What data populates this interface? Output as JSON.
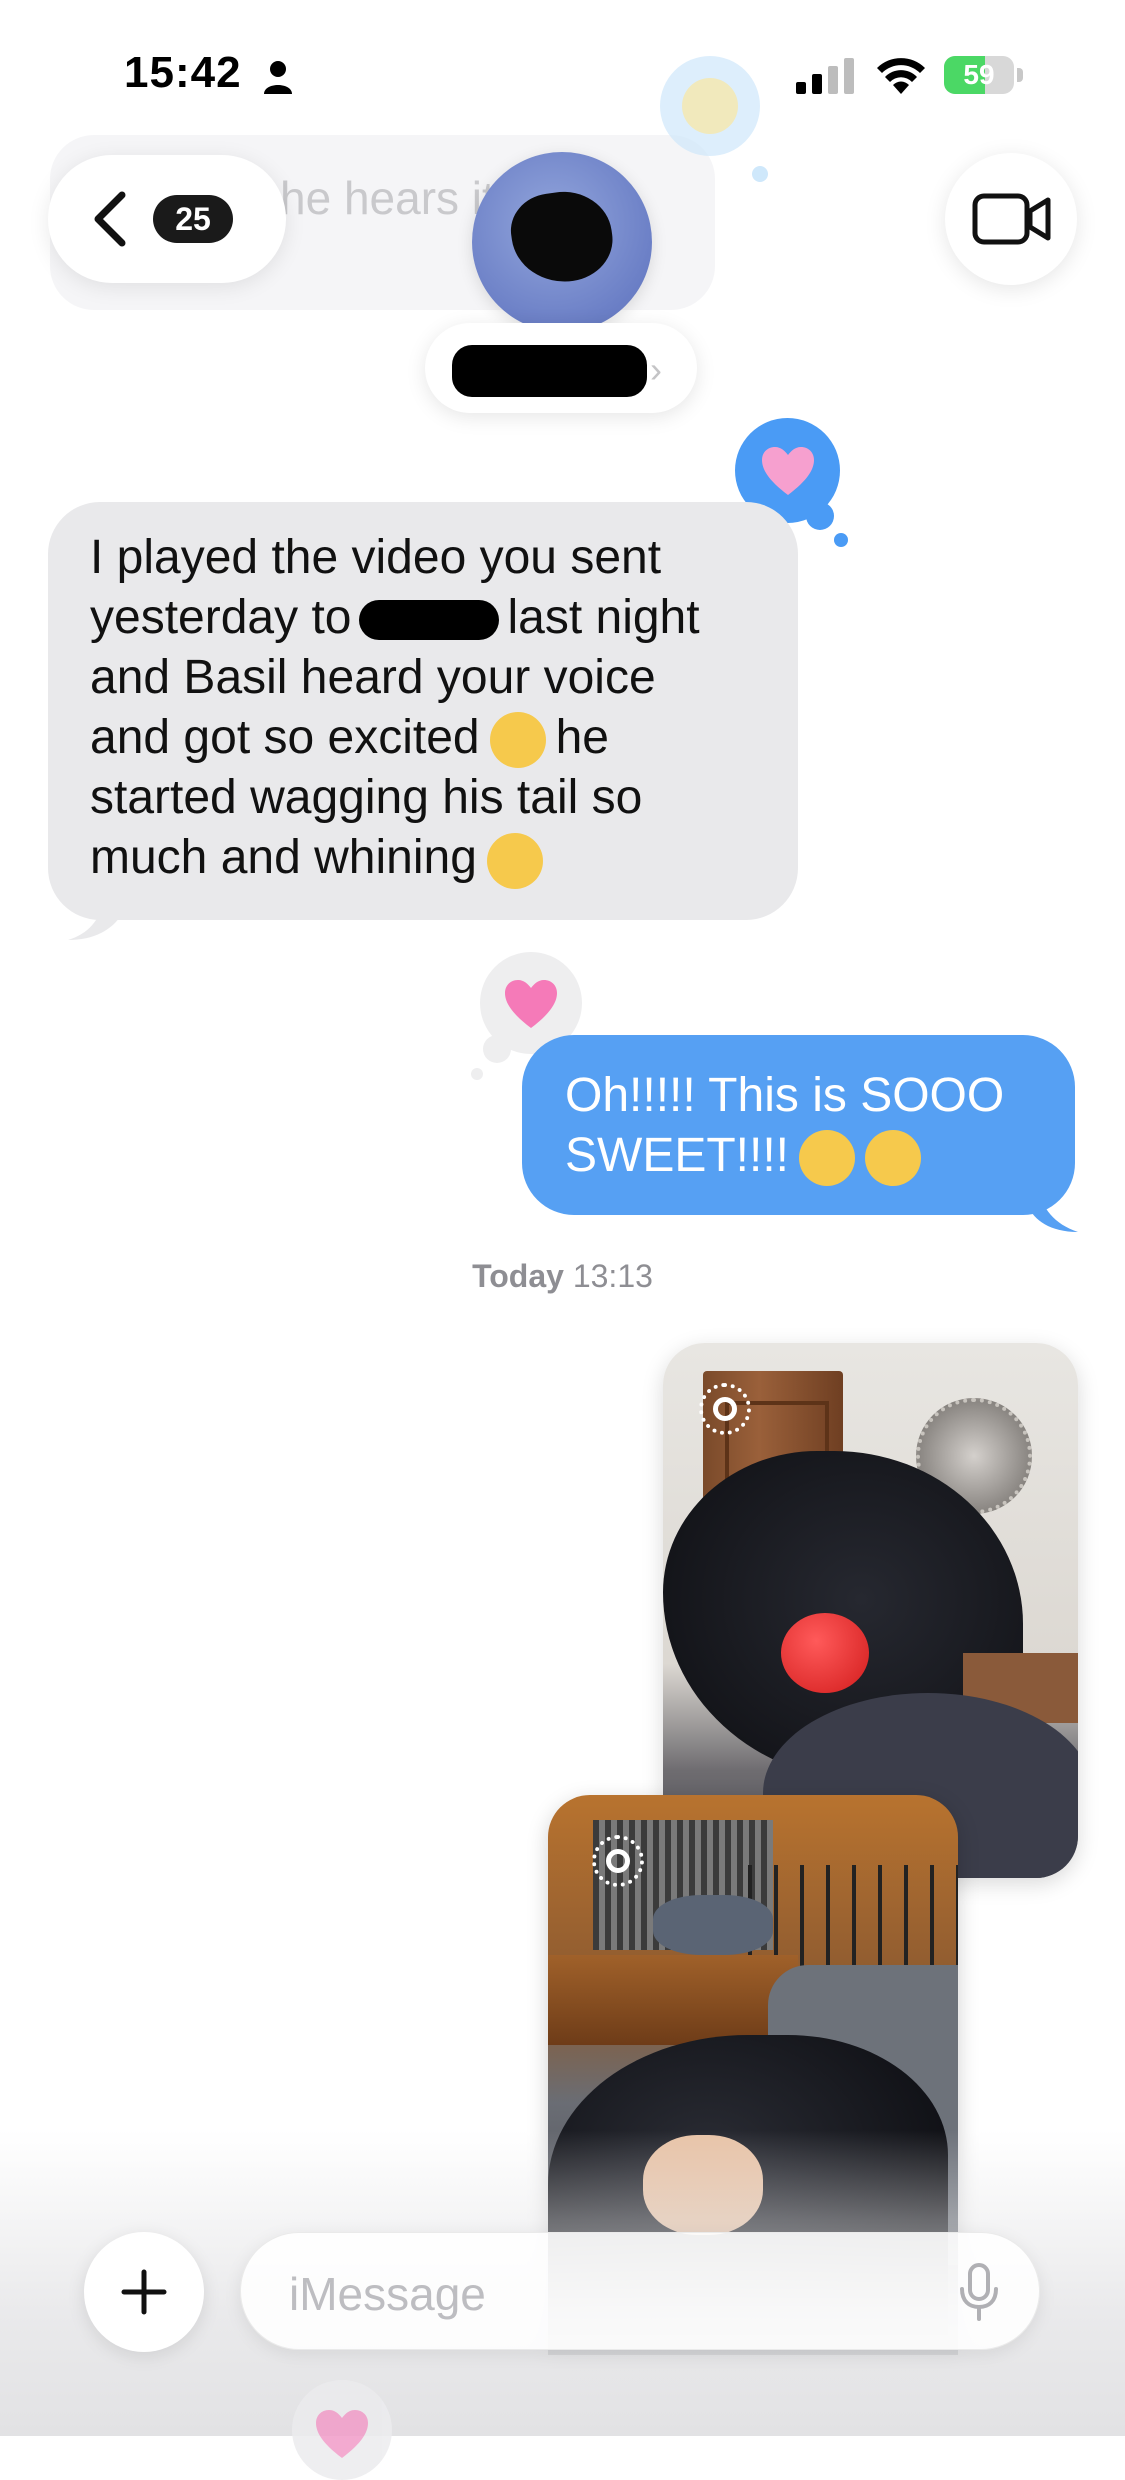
{
  "status_bar": {
    "time": "15:42",
    "battery_percent": "59",
    "battery_level": 0.59,
    "charging": true
  },
  "faded_message": {
    "text": "he hears it too"
  },
  "header": {
    "back_count": "25",
    "contact_name": "",
    "icons": [
      "chevron-left-icon",
      "video-camera-icon",
      "chevron-right-icon"
    ]
  },
  "messages": {
    "incoming": {
      "line1": "I played the video you sent",
      "line2a": "yesterday to",
      "line2b": "last night",
      "line3": "and Basil heard your voice",
      "line4a": "and got so excited",
      "line4b": "he",
      "line5": "started wagging his tail so",
      "line6a": "much and whining",
      "tapback": "heart"
    },
    "outgoing": {
      "line1": "Oh!!!!! This is SOOO",
      "line2": "SWEET!!!!",
      "tapback": "heart"
    },
    "timestamp_day": "Today",
    "timestamp_time": "13:13"
  },
  "composer": {
    "placeholder": "iMessage",
    "icons": [
      "plus-icon",
      "microphone-icon"
    ]
  },
  "colors": {
    "outgoing_bubble": "#56a0f3",
    "incoming_bubble": "#e9e9eb",
    "tapback_heart": "#f57ab8"
  }
}
